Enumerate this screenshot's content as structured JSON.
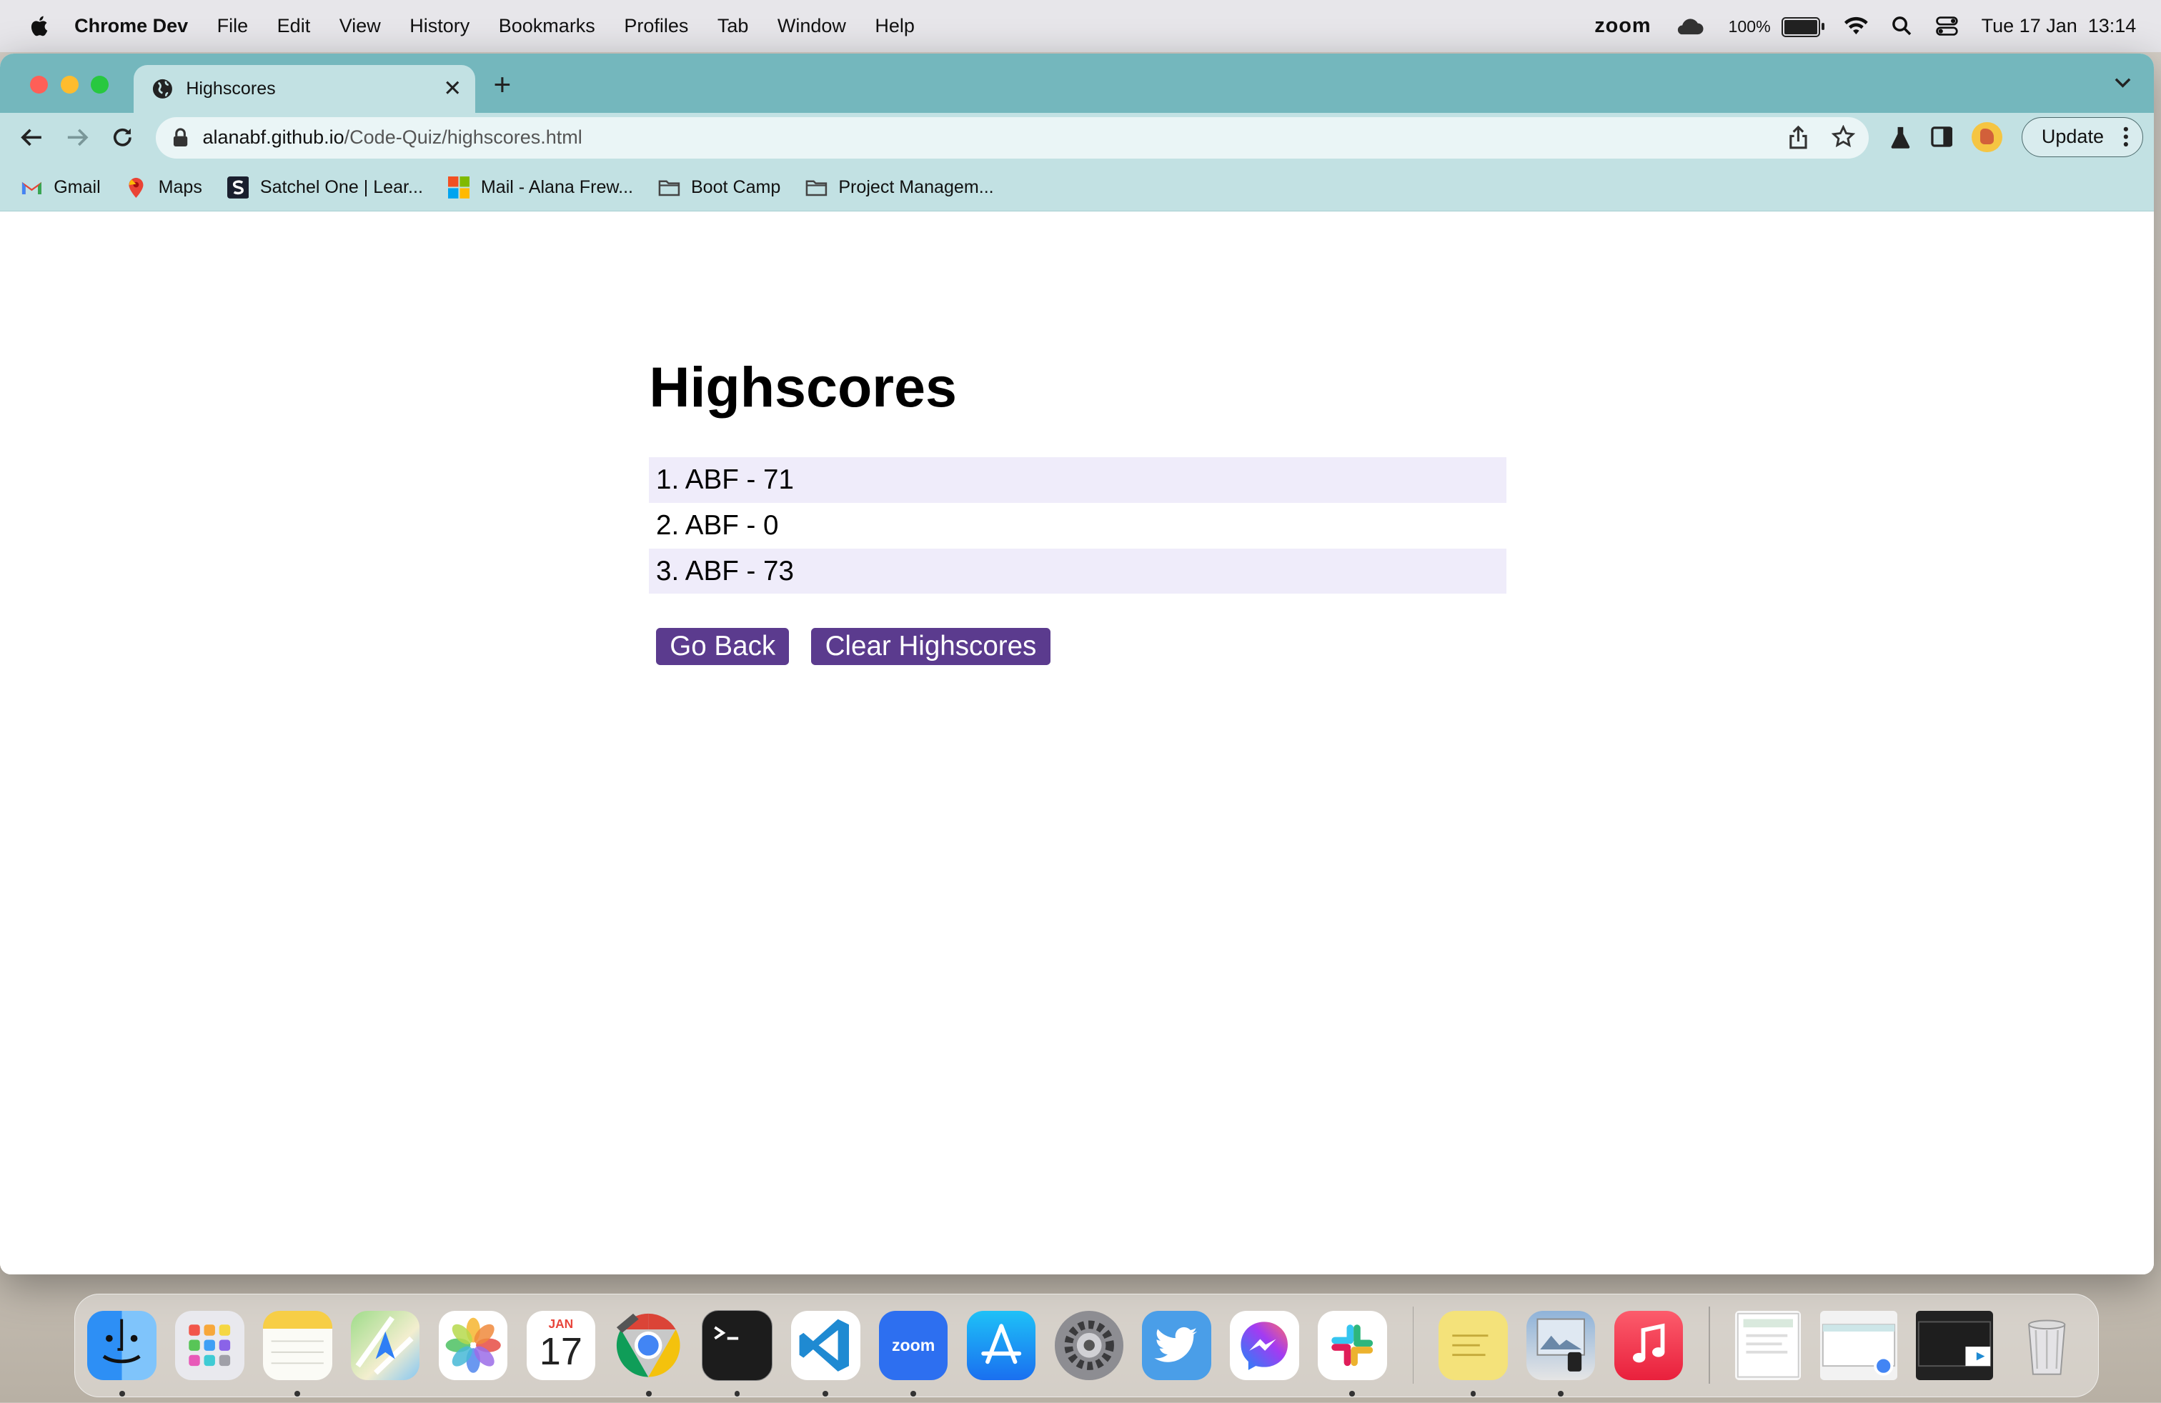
{
  "menubar": {
    "app_name": "Chrome Dev",
    "menus": [
      "File",
      "Edit",
      "View",
      "History",
      "Bookmarks",
      "Profiles",
      "Tab",
      "Window",
      "Help"
    ],
    "zoom_label": "zoom",
    "battery_percent": "100%",
    "datetime": "Tue 17 Jan  13:14"
  },
  "browser": {
    "tab_title": "Highscores",
    "url_host": "alanabf.github.io",
    "url_path": "/Code-Quiz/highscores.html",
    "update_label": "Update",
    "bookmarks": [
      "Gmail",
      "Maps",
      "Satchel One | Lear...",
      "Mail - Alana Frew...",
      "Boot Camp",
      "Project Managem..."
    ]
  },
  "page": {
    "title": "Highscores",
    "scores": [
      "1. ABF - 71",
      "2. ABF - 0",
      "3. ABF - 73"
    ],
    "go_back_label": "Go Back",
    "clear_label": "Clear Highscores",
    "accent_color": "#5b3b8e",
    "row_highlight_color": "#efecfa"
  },
  "dock": {
    "calendar_month": "JAN",
    "calendar_day": "17",
    "zoom_icon_label": "zoom",
    "apps": [
      "finder",
      "launchpad",
      "notes",
      "maps",
      "photos",
      "calendar",
      "chrome-dev",
      "terminal",
      "vscode",
      "zoom",
      "app-store",
      "system-settings",
      "twitter",
      "messenger",
      "slack",
      "stickies",
      "preview",
      "music"
    ]
  }
}
